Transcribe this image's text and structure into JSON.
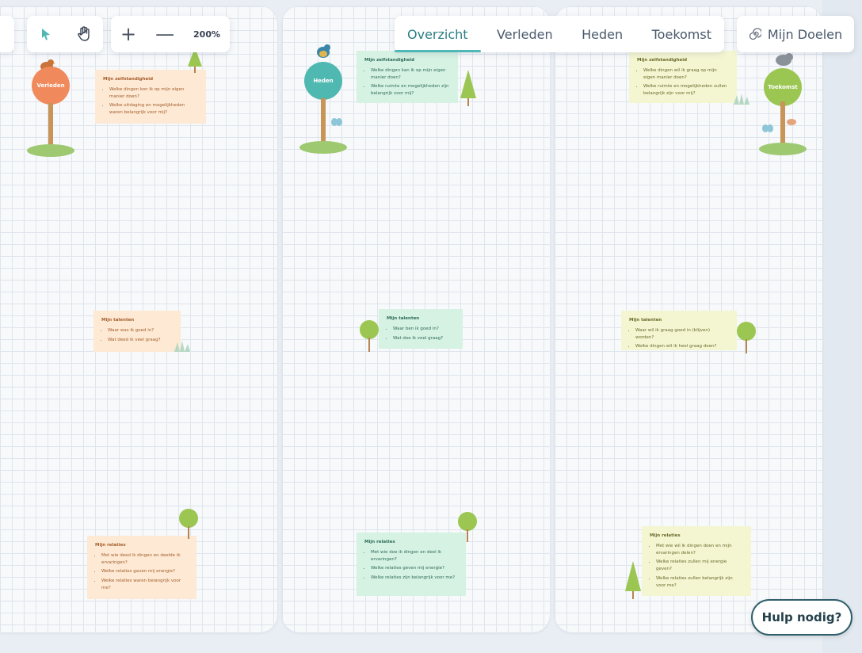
{
  "toolbar": {
    "tools": [
      {
        "icon": "select-cursor-icon"
      },
      {
        "icon": "hand-pan-icon"
      }
    ],
    "zoom_in": "+",
    "zoom_out": "—",
    "zoom_level": "200%"
  },
  "tabs": [
    {
      "label": "Overzicht",
      "active": true
    },
    {
      "label": "Verleden",
      "active": false
    },
    {
      "label": "Heden",
      "active": false
    },
    {
      "label": "Toekomst",
      "active": false
    }
  ],
  "goals_button": {
    "label": "Mijn Doelen",
    "icon": "spiral-icon"
  },
  "signposts": {
    "verleden": {
      "label": "Verleden",
      "color": "#f08a5d"
    },
    "heden": {
      "label": "Heden",
      "color": "#4fb8b0"
    },
    "toekomst": {
      "label": "Toekomst",
      "color": "#9cc652"
    }
  },
  "columns": {
    "verleden": {
      "zelfstandigheid": {
        "title": "Mijn zelfstandigheid",
        "bullets": [
          "Welke dingen kon ik op mijn eigen manier doen?",
          "Welke uitdaging en mogelijkheden waren belangrijk voor mij?"
        ]
      },
      "talenten": {
        "title": "Mijn talenten",
        "bullets": [
          "Waar was ik goed in?",
          "Wat deed ik veel graag?"
        ]
      },
      "relaties": {
        "title": "Mijn relaties",
        "bullets": [
          "Met wie deed ik dingen en deelde ik ervaringen?",
          "Welke relaties gaven mij energie?",
          "Welke relaties waren belangrijk voor me?"
        ]
      }
    },
    "heden": {
      "zelfstandigheid": {
        "title": "Mijn zelfstandigheid",
        "bullets": [
          "Welke dingen kan ik op mijn eigen manier doen?",
          "Welke ruimte en mogelijkheden zijn belangrijk voor mij?"
        ]
      },
      "talenten": {
        "title": "Mijn talenten",
        "bullets": [
          "Waar ben ik goed in?",
          "Wat doe ik veel graag?"
        ]
      },
      "relaties": {
        "title": "Mijn relaties",
        "bullets": [
          "Met wie doe ik dingen en deel ik ervaringen?",
          "Welke relaties geven mij energie?",
          "Welke relaties zijn belangrijk voor me?"
        ]
      }
    },
    "toekomst": {
      "zelfstandigheid": {
        "title": "Mijn zelfstandigheid",
        "bullets": [
          "Welke dingen wil ik graag op mijn eigen manier doen?",
          "Welke ruimte en mogelijkheden zullen belangrijk zijn voor mij?"
        ]
      },
      "talenten": {
        "title": "Mijn talenten",
        "bullets": [
          "Waar wil ik graag goed in (blijven) worden?",
          "Welke dingen wil ik heel graag doen?"
        ]
      },
      "relaties": {
        "title": "Mijn relaties",
        "bullets": [
          "Met wie wil ik dingen doen en mijn ervaringen delen?",
          "Welke relaties zullen mij energie geven?",
          "Welke relaties zullen belangrijk zijn voor me?"
        ]
      }
    }
  },
  "help_button": {
    "label": "Hulp nodig?"
  }
}
